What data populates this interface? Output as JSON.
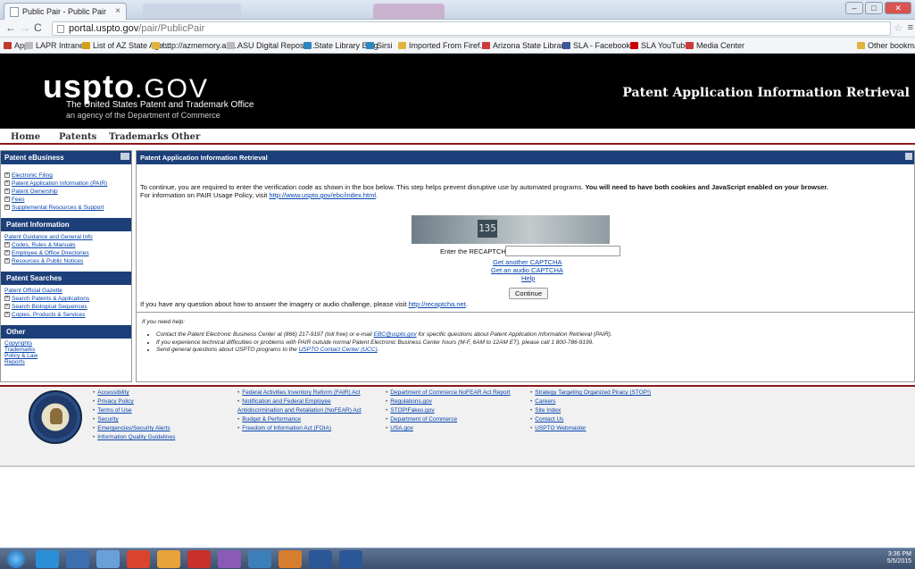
{
  "browser": {
    "tab_title": "Public Pair - Public Pair",
    "url_host": "portal.uspto.gov",
    "url_path": "/pair/PublicPair",
    "bookmarks": [
      {
        "label": "Apps",
        "color": "#c0392b"
      },
      {
        "label": "LAPR Intranet",
        "color": "#bbbbbb"
      },
      {
        "label": "List of AZ State Age...",
        "color": "#d4a017"
      },
      {
        "label": "http://azmemory.azl...",
        "color": "#e2b33c"
      },
      {
        "label": "ASU Digital Reposit...",
        "color": "#bbbbbb"
      },
      {
        "label": "State Library Blog",
        "color": "#2e86c1"
      },
      {
        "label": "Sirsi",
        "color": "#2e86c1"
      },
      {
        "label": "Imported From Firef...",
        "color": "#e2b33c"
      },
      {
        "label": "Arizona State Librar...",
        "color": "#cc3a3a"
      },
      {
        "label": "SLA - Facebook",
        "color": "#3b5998"
      },
      {
        "label": "SLA YouTube",
        "color": "#cc0000"
      },
      {
        "label": "Media Center",
        "color": "#cc3a3a"
      },
      {
        "label": "Other bookmarks",
        "color": "#e2b33c"
      }
    ]
  },
  "header": {
    "logo_main": "uspto",
    "logo_suffix": ".GOV",
    "subtitle1": "The United States Patent and Trademark Office",
    "subtitle2": "an agency of the Department of Commerce",
    "app_title": "Patent Application Information Retrieval"
  },
  "topnav": [
    "Home",
    "Patents",
    "Trademarks",
    "Other"
  ],
  "sidebar": {
    "ebusiness_title": "Patent eBusiness",
    "ebusiness_items": [
      "Electronic Filing",
      "Patent Application Information (PAIR)",
      "Patent Ownership",
      "Fees",
      "Supplemental Resources & Support"
    ],
    "info_title": "Patent Information",
    "info_items": [
      "Patent Guidance and General Info",
      "Codes, Rules & Manuals",
      "Employee & Office Directories",
      "Resources & Public Notices"
    ],
    "search_title": "Patent Searches",
    "search_items": [
      "Patent Official Gazette",
      "Search Patents & Applications",
      "Search Biological Sequences",
      "Copies, Products & Services"
    ],
    "other_title": "Other",
    "other_items": [
      "Copyrights",
      "Trademarks",
      "Policy & Law",
      "Reports"
    ]
  },
  "main": {
    "panel_title": "Patent Application Information Retrieval",
    "intro_text": "To continue, you are required to enter the verification code as shown in the box below. This step helps prevent disruptive use by automated programs. ",
    "intro_bold": "You will need to have both cookies and JavaScript enabled on your browser.",
    "policy_text": "For information on PAIR Usage Policy, visit ",
    "policy_link": "http://www.uspto.gov/ebc/index.html",
    "captcha_digits": "135",
    "captcha_label": "Enter the RECAPTCHA text :",
    "another_captcha": "Get another CAPTCHA",
    "audio_captcha": "Get an audio CAPTCHA",
    "help_link": "Help",
    "continue_label": "Continue",
    "question_text": "If you have any question about how to answer the imagery or audio challenge, please visit ",
    "question_link": "http://recaptcha.net",
    "help_title": "If you need help:",
    "help_1a": "Contact the Patent Electronic Business Center at (866) 217-9197 (toll free) or e-mail ",
    "help_1_link": "EBC@uspto.gov",
    "help_1b": " for specific questions about Patent Application Information Retrieval (PAIR).",
    "help_2": "If you experience technical difficulties or problems with PAIR outside normal Patent Electronic Business Center hours (M-F, 6AM to 12AM ET), please call 1 800-786-9199.",
    "help_3a": "Send general questions about USPTO programs to the ",
    "help_3_link": "USPTO Contact Center (UCC)",
    "help_3b": "."
  },
  "footer": {
    "col1": [
      "Accessibility",
      "Privacy Policy",
      "Terms of Use",
      "Security",
      "Emergencies/Security Alerts",
      "Information Quality Guidelines"
    ],
    "col2": [
      "Federal Activities Inventory Reform (FAIR) Act",
      "Notification and Federal Employee Antidiscrimination and Retaliation (NoFEAR) Act",
      "Budget & Performance",
      "Freedom of Information Act (FOIA)"
    ],
    "col3": [
      "Department of Commerce NoFEAR Act Report",
      "Regulations.gov",
      "STOP!Fakes.gov",
      "Department of Commerce",
      "USA.gov"
    ],
    "col4": [
      "Strategy Targeting Organized Piracy (STOP!)",
      "Careers",
      "Site Index",
      "Contact Us",
      "USPTO Webmaster"
    ]
  },
  "taskbar": {
    "time": "3:36 PM",
    "date": "5/5/2015",
    "icons": [
      "start-orb",
      "ie",
      "explorer",
      "media",
      "chrome",
      "outlook",
      "acrobat",
      "paint",
      "publisher",
      "firefox",
      "word",
      "word2"
    ]
  }
}
